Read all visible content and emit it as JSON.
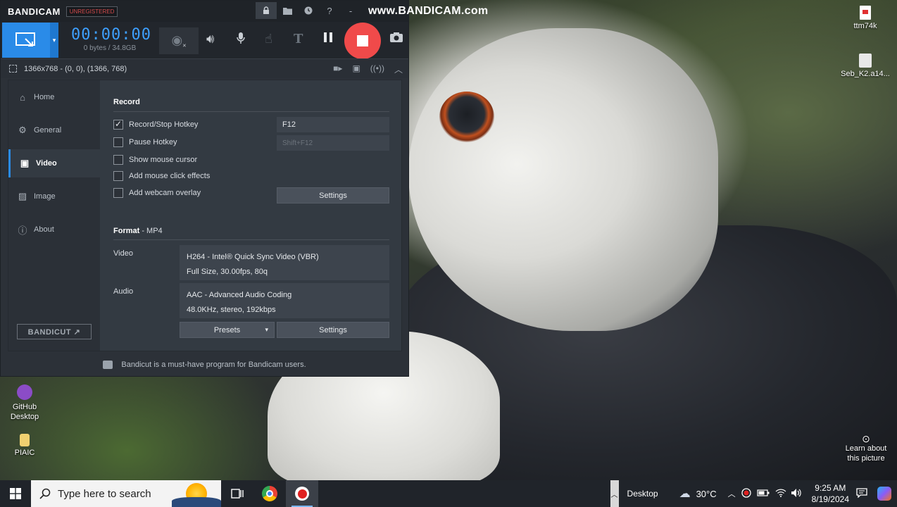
{
  "bandicam": {
    "logo": "BANDICAM",
    "unregistered": "UNREGISTERED",
    "url_overlay": "www.BANDICAM.com",
    "timer": "00:00:00",
    "size": "0 bytes / 34.8GB",
    "resolution": "1366x768 - (0, 0), (1366, 768)",
    "nav": [
      {
        "label": "Home",
        "icon": "home-icon"
      },
      {
        "label": "General",
        "icon": "gear-icon"
      },
      {
        "label": "Video",
        "icon": "video-settings-icon",
        "active": true
      },
      {
        "label": "Image",
        "icon": "image-icon"
      },
      {
        "label": "About",
        "icon": "info-icon"
      }
    ],
    "bandicut_label": "BANDICUT ↗",
    "record": {
      "title": "Record",
      "options": [
        {
          "label": "Record/Stop Hotkey",
          "checked": true
        },
        {
          "label": "Pause Hotkey",
          "checked": false
        },
        {
          "label": "Show mouse cursor",
          "checked": false
        },
        {
          "label": "Add mouse click effects",
          "checked": false
        },
        {
          "label": "Add webcam overlay",
          "checked": false
        }
      ],
      "hotkey_record": "F12",
      "hotkey_pause": "Shift+F12",
      "settings_label": "Settings"
    },
    "format": {
      "title": "Format",
      "container": " - MP4",
      "video_label": "Video",
      "video_line1": "H264 - Intel® Quick Sync Video (VBR)",
      "video_line2": "Full Size, 30.00fps, 80q",
      "audio_label": "Audio",
      "audio_line1": "AAC - Advanced Audio Coding",
      "audio_line2": "48.0KHz, stereo, 192kbps",
      "presets_label": "Presets",
      "settings_label": "Settings"
    },
    "footer": "Bandicut is a must-have program for Bandicam users."
  },
  "desktop": {
    "icons_right": [
      {
        "label": "ttm74k"
      },
      {
        "label": "Seb_K2.a14..."
      }
    ],
    "icons_left": [
      {
        "label": "GitHub Desktop"
      },
      {
        "label": "PIAIC"
      }
    ],
    "learn_about": "Learn about this picture"
  },
  "taskbar": {
    "search_placeholder": "Type here to search",
    "desktop_label": "Desktop",
    "weather": "30°C",
    "time": "9:25 AM",
    "date": "8/19/2024"
  }
}
